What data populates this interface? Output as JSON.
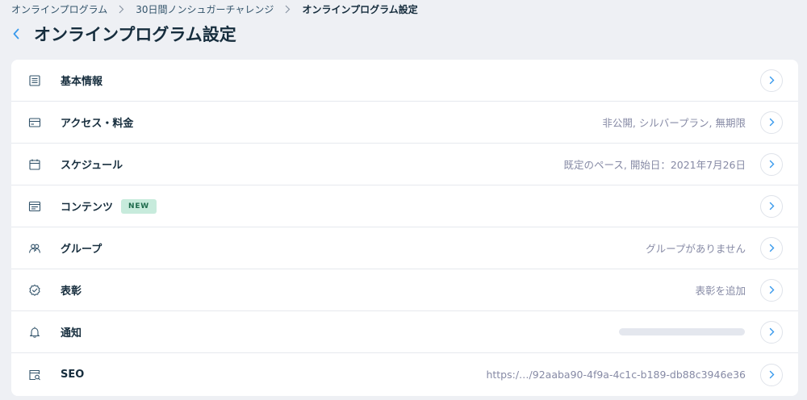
{
  "breadcrumb": {
    "items": [
      "オンラインプログラム",
      "30日間ノンシュガーチャレンジ",
      "オンラインプログラム設定"
    ]
  },
  "header": {
    "title": "オンラインプログラム設定"
  },
  "settings": {
    "rows": [
      {
        "label": "基本情報",
        "value": "",
        "icon": "document-lines-icon"
      },
      {
        "label": "アクセス・料金",
        "value": "非公開, シルバープラン, 無期限",
        "icon": "credit-card-icon"
      },
      {
        "label": "スケジュール",
        "value": "既定のペース, 開始日：2021年7月26日",
        "icon": "calendar-icon"
      },
      {
        "label": "コンテンツ",
        "value": "",
        "badge": "NEW",
        "icon": "content-icon"
      },
      {
        "label": "グループ",
        "value": "グループがありません",
        "icon": "group-icon"
      },
      {
        "label": "表彰",
        "value": "表彰を追加",
        "icon": "badge-check-icon"
      },
      {
        "label": "通知",
        "value": "",
        "loading": true,
        "icon": "bell-icon"
      },
      {
        "label": "SEO",
        "value": "https:/…/92aaba90-4f9a-4c1c-b189-db88c3946e36",
        "icon": "seo-search-icon"
      }
    ]
  },
  "colors": {
    "accent": "#3899ec",
    "text": "#162d3d",
    "muted": "#868aa5",
    "background": "#eef0f4",
    "badge_bg": "#c7ebdc"
  }
}
